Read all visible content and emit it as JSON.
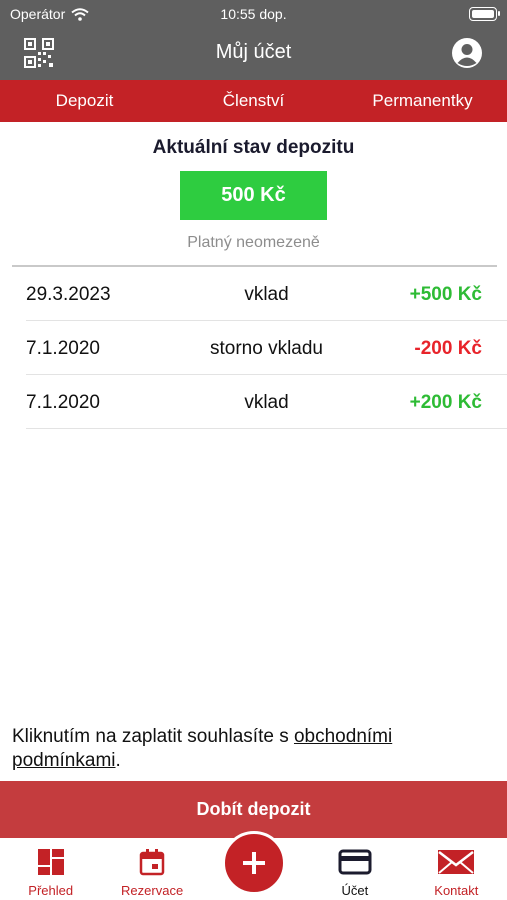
{
  "status_bar": {
    "carrier": "Operátor",
    "time": "10:55 dop."
  },
  "header": {
    "title": "Můj účet"
  },
  "tabs": [
    {
      "label": "Depozit"
    },
    {
      "label": "Členství"
    },
    {
      "label": "Permanentky"
    }
  ],
  "deposit": {
    "title": "Aktuální stav depozitu",
    "balance": "500 Kč",
    "validity": "Platný neomezeně"
  },
  "transactions": [
    {
      "date": "29.3.2023",
      "type": "vklad",
      "amount": "+500 Kč"
    },
    {
      "date": "7.1.2020",
      "type": "storno vkladu",
      "amount": "-200 Kč"
    },
    {
      "date": "7.1.2020",
      "type": "vklad",
      "amount": "+200 Kč"
    }
  ],
  "terms": {
    "text": "Kliknutím na zaplatit souhlasíte s ",
    "link": "obchodními podmínkami",
    "suffix": "."
  },
  "topup_button": "Dobít depozit",
  "bottom_nav": [
    {
      "label": "Přehled",
      "icon": "dashboard-icon"
    },
    {
      "label": "Rezervace",
      "icon": "calendar-icon"
    },
    {
      "label": "",
      "icon": "plus-icon"
    },
    {
      "label": "Účet",
      "icon": "card-icon"
    },
    {
      "label": "Kontakt",
      "icon": "mail-icon"
    }
  ],
  "colors": {
    "accent_red": "#c32226",
    "header_gray": "#5f5f5f",
    "balance_green": "#2ecc40",
    "positive_green": "#2ebb35",
    "negative_red": "#e8232a"
  }
}
